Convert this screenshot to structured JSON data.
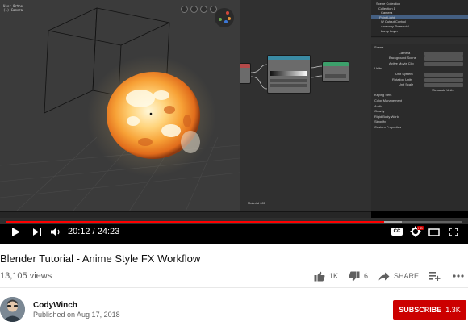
{
  "video": {
    "viewport_header": [
      "User Ortho",
      "(1) Camera"
    ],
    "node_editor_label": "Material 001",
    "outliner_items": [
      "Scene Collection",
      "Collection 1",
      "Camera",
      "Point Light",
      "W Output Control",
      "Anatomy Threshold",
      "Lamp Layer"
    ],
    "properties_sections": [
      "Scene",
      "Camera",
      "Background Scene",
      "Active Movie Clip",
      "Units",
      "Unit System",
      "Rotation Units",
      "Unit Scale",
      "Separate Units",
      "Keying Sets",
      "Color Management",
      "Audio",
      "Gravity",
      "Rigid Body World",
      "Simplify",
      "Custom Properties"
    ],
    "time_current": "20:12",
    "time_separator": "/",
    "time_total": "24:23",
    "progress_fraction": 0.829,
    "buffered_fraction": 0.868,
    "cc_label": "CC"
  },
  "meta": {
    "title": "Blender Tutorial - Anime Style FX Workflow",
    "views": "13,105 views",
    "likes": "1K",
    "dislikes": "6",
    "share_label": "SHARE",
    "channel_name": "CodyWinch",
    "published": "Published on Aug 17, 2018",
    "subscribe_label": "SUBSCRIBE",
    "subscriber_count": "1.3K"
  },
  "colors": {
    "accent": "#ff0000",
    "subscribe": "#cc0000",
    "muted_text": "#606060"
  }
}
